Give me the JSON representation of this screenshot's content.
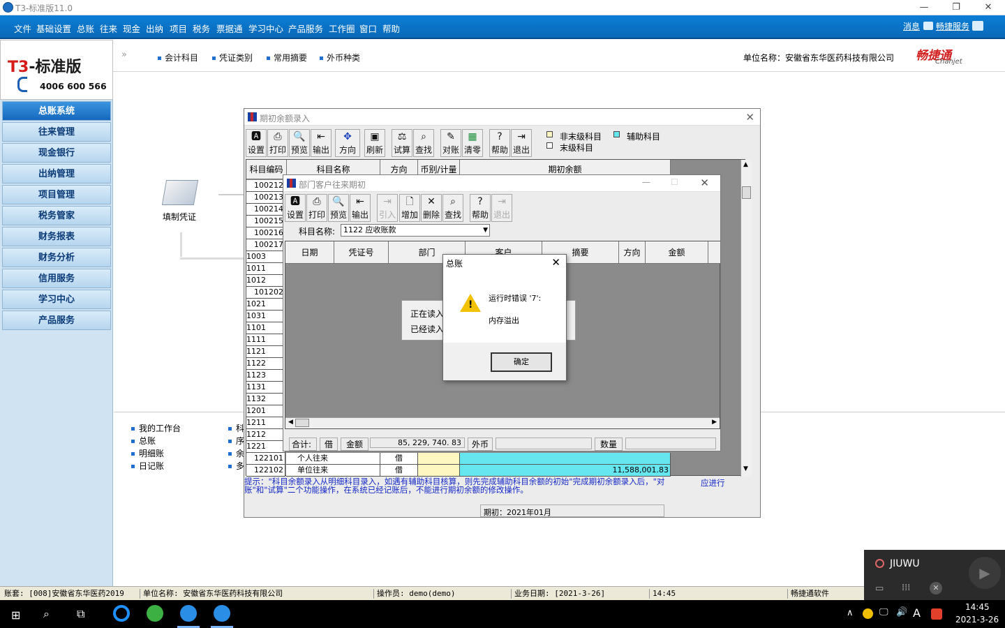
{
  "app": {
    "title": "T3-标准版11.0"
  },
  "menu": {
    "items": [
      "文件",
      "基础设置",
      "总账",
      "往来",
      "现金",
      "出纳",
      "项目",
      "税务",
      "票据通",
      "学习中心",
      "产品服务",
      "工作圈",
      "窗口",
      "帮助"
    ],
    "message": "消息",
    "service": "畅捷服务"
  },
  "logo": {
    "brand_a": "T3",
    "brand_b": "-标准版",
    "phone": "4006 600 566"
  },
  "toolstrip": {
    "items": [
      "会计科目",
      "凭证类别",
      "常用摘要",
      "外币种类"
    ],
    "company_label": "单位名称：安徽省东华医药科技有限公司",
    "chanjet_cn": "畅捷通",
    "chanjet_en": "Chanjet"
  },
  "sidebar": {
    "items": [
      "总账系统",
      "往来管理",
      "现金银行",
      "出纳管理",
      "项目管理",
      "税务管家",
      "财务报表",
      "财务分析",
      "信用服务",
      "学习中心",
      "产品服务"
    ]
  },
  "main": {
    "voucher_label": "填制凭证"
  },
  "bottom_links": [
    "我的工作台",
    "总账",
    "明细账",
    "日记账"
  ],
  "bottom_links_clipped": [
    "科",
    "序",
    "余",
    "多"
  ],
  "win_balance": {
    "title": "期初余额录入",
    "toolbar": [
      "设置",
      "打印",
      "预览",
      "输出",
      "方向",
      "刷新",
      "试算",
      "查找",
      "对账",
      "清零",
      "帮助",
      "退出"
    ],
    "legend_nonleaf": "非末级科目",
    "legend_aux": "辅助科目",
    "legend_leaf": "末级科目",
    "headers": [
      "科目编码",
      "科目名称",
      "方向",
      "币别/计量",
      "期初余额"
    ],
    "codes": [
      "100212",
      "100213",
      "100214",
      "100215",
      "100216",
      "100217",
      "1003",
      "1011",
      "1012",
      "101202",
      "1021",
      "1031",
      "1101",
      "1111",
      "1121",
      "1122",
      "1123",
      "1131",
      "1132",
      "1201",
      "1211",
      "1212",
      "1221",
      "122101",
      "122102"
    ],
    "row_122101": {
      "name": "个人往来",
      "dir": "借"
    },
    "row_122102": {
      "name": "单位往来",
      "dir": "借",
      "amount": "11,588,001.83"
    },
    "hint": "提示：\"科目余额录入从明细科目录入，如遇有辅助科目核算，则先完成辅助科目余额的初始\"完成期初余额录入后，\"对账\"和\"试算\"二个功能操作，在系统已经记账后，不能进行期初余额的修改操作。",
    "apply_link": "应进行",
    "period": "期初：2021年01月"
  },
  "win_dept": {
    "title": "部门客户往来期初",
    "toolbar": [
      "设置",
      "打印",
      "预览",
      "输出",
      "引入",
      "增加",
      "删除",
      "查找",
      "帮助",
      "退出"
    ],
    "subject_label": "科目名称:",
    "subject_value": "1122 应收账款",
    "headers": [
      "日期",
      "凭证号",
      "部门",
      "客户",
      "摘要",
      "方向",
      "金额"
    ],
    "progress_line1": "正在读入",
    "progress_line2": "已经读入",
    "footer": {
      "total": "合计:",
      "debit": "借",
      "amount_label": "金额",
      "amount": "85, 229, 740. 83",
      "fx_label": "外币",
      "qty_label": "数量"
    }
  },
  "dialog": {
    "title": "总账",
    "line1": "运行时错误 '7':",
    "line2": "内存溢出",
    "ok": "确定"
  },
  "status": {
    "account": "账套: [008]安徽省东华医药2019",
    "company": "单位名称: 安徽省东华医药科技有限公司",
    "operator": "操作员: demo(demo)",
    "date": "业务日期: [2021-3-26]",
    "time": "14:45",
    "vendor": "畅捷通软件"
  },
  "notification": {
    "name": "JIUWU"
  },
  "taskbar": {
    "time": "14:45",
    "date": "2021-3-26",
    "ime": "A"
  },
  "colors": {
    "menubar": "#0b7fd6",
    "cyan": "#66e6ee",
    "yellow": "#fff7c2"
  }
}
